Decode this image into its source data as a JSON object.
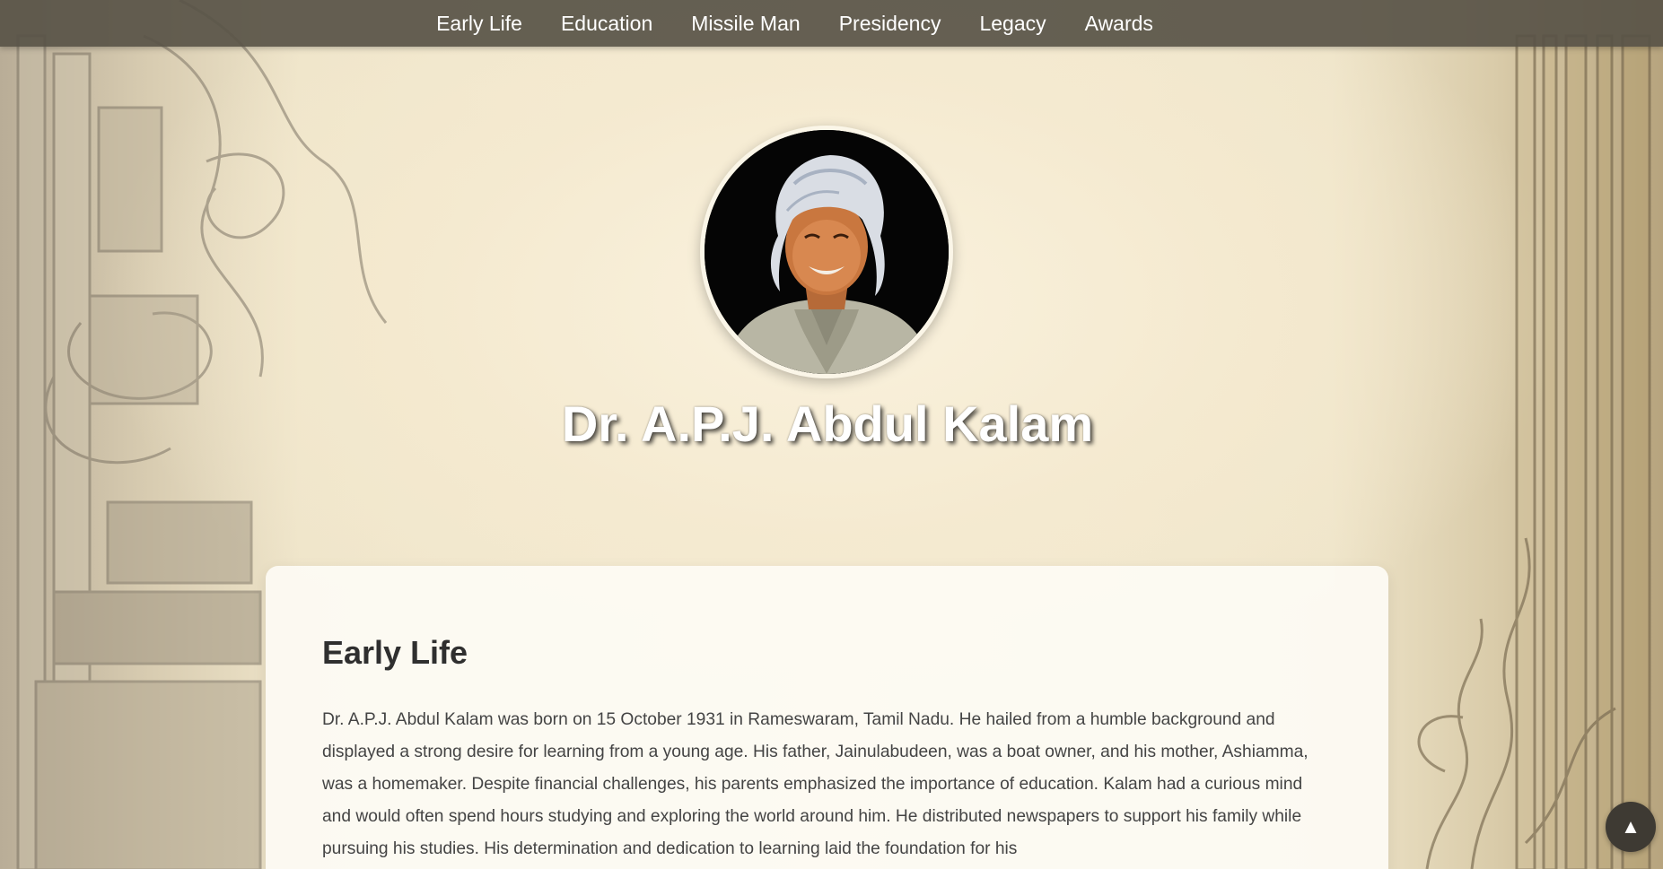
{
  "nav": {
    "items": [
      {
        "label": "Early Life"
      },
      {
        "label": "Education"
      },
      {
        "label": "Missile Man"
      },
      {
        "label": "Presidency"
      },
      {
        "label": "Legacy"
      },
      {
        "label": "Awards"
      }
    ]
  },
  "hero": {
    "title": "Dr. A.P.J. Abdul Kalam"
  },
  "section": {
    "heading": "Early Life",
    "body": "Dr. A.P.J. Abdul Kalam was born on 15 October 1931 in Rameswaram, Tamil Nadu. He hailed from a humble background and displayed a strong desire for learning from a young age. His father, Jainulabudeen, was a boat owner, and his mother, Ashiamma, was a homemaker. Despite financial challenges, his parents emphasized the importance of education. Kalam had a curious mind and would often spend hours studying and exploring the world around him. He distributed newspapers to support his family while pursuing his studies. His determination and dedication to learning laid the foundation for his"
  },
  "scroll_top": {
    "icon": "▲"
  }
}
